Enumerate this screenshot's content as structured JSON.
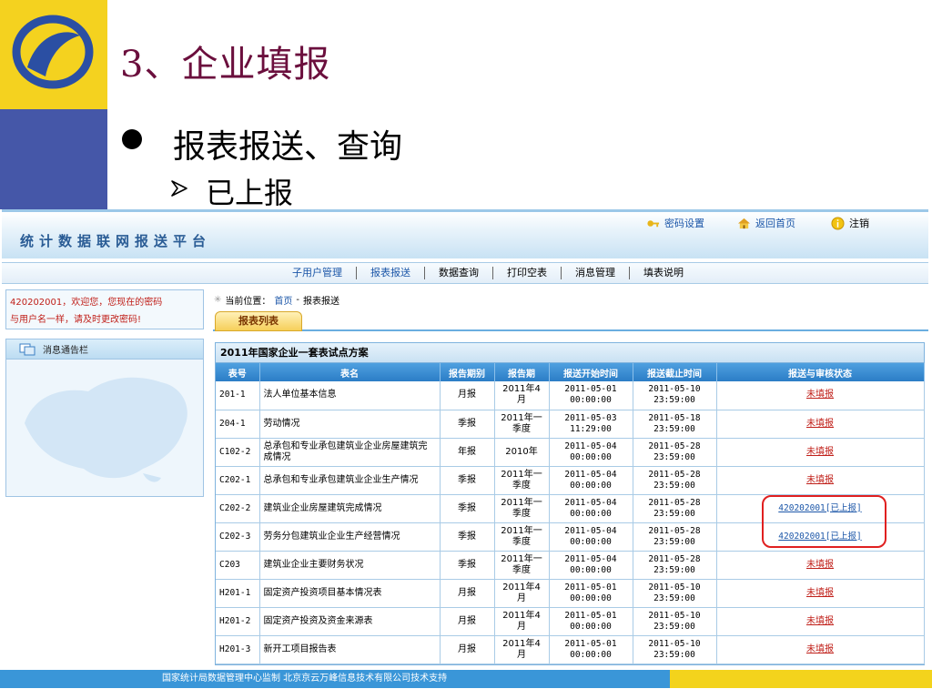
{
  "slide": {
    "title": "3、企业填报",
    "bullet": "报表报送、查询",
    "sub_bullet": "已上报"
  },
  "header": {
    "platform_title": "统计数据联网报送平台",
    "links": {
      "password": "密码设置",
      "home": "返回首页",
      "logout": "注销"
    }
  },
  "nav": {
    "items": [
      "子用户管理",
      "报表报送",
      "数据查询",
      "打印空表",
      "消息管理",
      "填表说明"
    ]
  },
  "sidebar": {
    "welcome_line1": "420202001，欢迎您，您现在的密码",
    "welcome_line2": "与用户名一样，请及时更改密码!",
    "notice_title": "消息通告栏"
  },
  "breadcrumb": {
    "prefix": "当前位置：",
    "home": "首页",
    "separator": "-",
    "current": "报表报送"
  },
  "tab": {
    "label": "报表列表"
  },
  "table": {
    "caption": "2011年国家企业一套表试点方案",
    "headers": [
      "表号",
      "表名",
      "报告期别",
      "报告期",
      "报送开始时间",
      "报送截止时间",
      "报送与审核状态"
    ],
    "rows": [
      {
        "code": "201-1",
        "name": "法人单位基本信息",
        "period_type": "月报",
        "period": "2011年4月",
        "start": [
          "2011-05-01",
          "00:00:00"
        ],
        "end": [
          "2011-05-10",
          "23:59:00"
        ],
        "status": "未填报",
        "reported": false
      },
      {
        "code": "204-1",
        "name": "劳动情况",
        "period_type": "季报",
        "period": "2011年一季度",
        "start": [
          "2011-05-03",
          "11:29:00"
        ],
        "end": [
          "2011-05-18",
          "23:59:00"
        ],
        "status": "未填报",
        "reported": false
      },
      {
        "code": "C102-2",
        "name": "总承包和专业承包建筑业企业房屋建筑完成情况",
        "period_type": "年报",
        "period": "2010年",
        "start": [
          "2011-05-04",
          "00:00:00"
        ],
        "end": [
          "2011-05-28",
          "23:59:00"
        ],
        "status": "未填报",
        "reported": false
      },
      {
        "code": "C202-1",
        "name": "总承包和专业承包建筑业企业生产情况",
        "period_type": "季报",
        "period": "2011年一季度",
        "start": [
          "2011-05-04",
          "00:00:00"
        ],
        "end": [
          "2011-05-28",
          "23:59:00"
        ],
        "status": "未填报",
        "reported": false
      },
      {
        "code": "C202-2",
        "name": "建筑业企业房屋建筑完成情况",
        "period_type": "季报",
        "period": "2011年一季度",
        "start": [
          "2011-05-04",
          "00:00:00"
        ],
        "end": [
          "2011-05-28",
          "23:59:00"
        ],
        "status": "420202001[已上报]",
        "reported": true
      },
      {
        "code": "C202-3",
        "name": "劳务分包建筑业企业生产经营情况",
        "period_type": "季报",
        "period": "2011年一季度",
        "start": [
          "2011-05-04",
          "00:00:00"
        ],
        "end": [
          "2011-05-28",
          "23:59:00"
        ],
        "status": "420202001[已上报]",
        "reported": true
      },
      {
        "code": "C203",
        "name": "建筑业企业主要财务状况",
        "period_type": "季报",
        "period": "2011年一季度",
        "start": [
          "2011-05-04",
          "00:00:00"
        ],
        "end": [
          "2011-05-28",
          "23:59:00"
        ],
        "status": "未填报",
        "reported": false
      },
      {
        "code": "H201-1",
        "name": "固定资产投资项目基本情况表",
        "period_type": "月报",
        "period": "2011年4月",
        "start": [
          "2011-05-01",
          "00:00:00"
        ],
        "end": [
          "2011-05-10",
          "23:59:00"
        ],
        "status": "未填报",
        "reported": false
      },
      {
        "code": "H201-2",
        "name": "固定资产投资及资金来源表",
        "period_type": "月报",
        "period": "2011年4月",
        "start": [
          "2011-05-01",
          "00:00:00"
        ],
        "end": [
          "2011-05-10",
          "23:59:00"
        ],
        "status": "未填报",
        "reported": false
      },
      {
        "code": "H201-3",
        "name": "新开工项目报告表",
        "period_type": "月报",
        "period": "2011年4月",
        "start": [
          "2011-05-01",
          "00:00:00"
        ],
        "end": [
          "2011-05-10",
          "23:59:00"
        ],
        "status": "未填报",
        "reported": false
      }
    ]
  },
  "footer": {
    "text": "国家统计局数据管理中心监制  北京京云万峰信息技术有限公司技术支持"
  },
  "colors": {
    "slide_yellow": "#f4d21f",
    "slide_blue": "#4557a8",
    "title_maroon": "#6b0f3d",
    "link_blue": "#1b56a8",
    "unfilled_red": "#c0201a",
    "table_header_blue": "#2b7dc6",
    "footer_blue": "#3a96d8",
    "footer_yellow": "#f3d31c"
  }
}
